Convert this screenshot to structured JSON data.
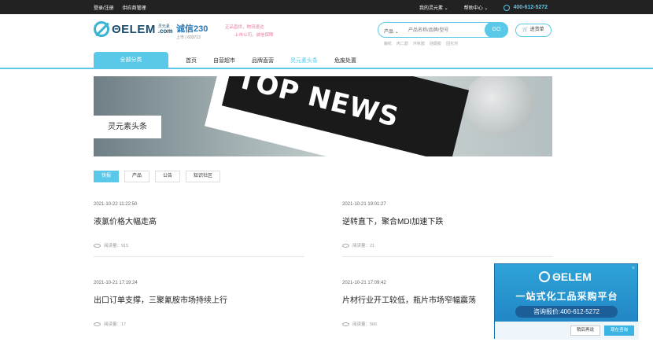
{
  "topbar": {
    "login": "登录/注册",
    "supplier": "供应商管理",
    "my": "我的灵元素",
    "help": "帮助中心",
    "phone": "400-612-5272"
  },
  "header": {
    "logo_text": "ΘELEM",
    "logo_cn": "灵元素",
    "logo_com": ".com",
    "chengxin": "诚信230",
    "chengxin_sub": "上市 | 603713",
    "slogan1": "正品直供，物流速达",
    "slogan2": "上市公司，诚信保障",
    "search_cat": "产品",
    "search_placeholder": "产品名称/品牌/型号",
    "search_go": "GO",
    "hot": [
      "胸杭",
      "丙二醇",
      "环氧胺",
      "硅酮胶",
      "固化剂"
    ],
    "cart": "进货单"
  },
  "nav": {
    "all": "全部分类",
    "items": [
      "首页",
      "自营超市",
      "品牌直营",
      "灵元素头条",
      "危废处置"
    ]
  },
  "banner": {
    "headline": "TOP NEWS",
    "label": "灵元素头条"
  },
  "tabs": [
    "快报",
    "产品",
    "公告",
    "知识社区"
  ],
  "articles": [
    {
      "date": "2021-10-22 11:22:50",
      "title": "液氯价格大幅走高",
      "reads": "阅读量：915"
    },
    {
      "date": "2021-10-21 19:01:27",
      "title": "逆转直下，聚合MDI加速下跌",
      "reads": "阅读量：21"
    },
    {
      "date": "2021-10-21 17:19:24",
      "title": "出口订单支撑，三聚氰胺市场持续上行",
      "reads": "阅读量：17"
    },
    {
      "date": "2021-10-21 17:09:42",
      "title": "片材行业开工较低，瓶片市场窄幅震荡",
      "reads": "阅读量：566"
    }
  ],
  "float": {
    "logo": "ΘELEM",
    "slogan": "一站式化工品采购平台",
    "hotline": "咨询报价:400-612-5272",
    "later": "稍后再说",
    "consult": "现在咨询",
    "close": "×"
  }
}
